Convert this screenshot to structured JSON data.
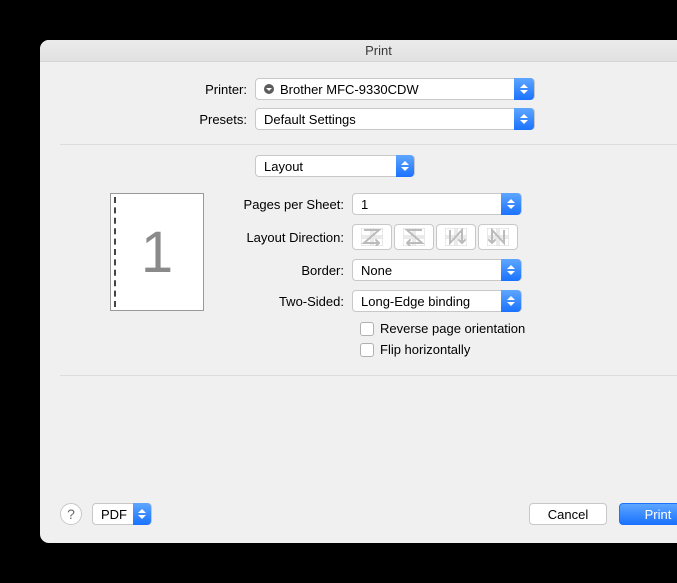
{
  "window": {
    "title": "Print"
  },
  "labels": {
    "printer": "Printer:",
    "presets": "Presets:",
    "section": "Layout",
    "pages_per_sheet": "Pages per Sheet:",
    "layout_direction": "Layout Direction:",
    "border": "Border:",
    "two_sided": "Two-Sided:",
    "reverse": "Reverse page orientation",
    "flip": "Flip horizontally"
  },
  "values": {
    "printer": "Brother MFC-9330CDW",
    "presets": "Default Settings",
    "pages_per_sheet": "1",
    "border": "None",
    "two_sided": "Long-Edge binding",
    "preview_page_number": "1"
  },
  "footer": {
    "pdf": "PDF",
    "cancel": "Cancel",
    "print": "Print",
    "help": "?"
  }
}
